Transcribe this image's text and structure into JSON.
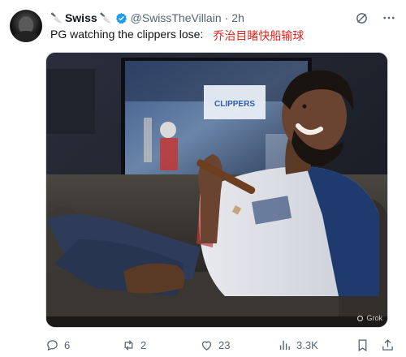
{
  "tweet": {
    "display_name": "Swiss",
    "name_decoration": "🔪",
    "handle": "@SwissTheVillain",
    "separator": "·",
    "time": "2h",
    "text_en": "PG watching the clippers lose:",
    "text_cn": "乔治目睹快船输球",
    "media_watermark": "Grok",
    "scoreboard_text": "CLIPPERS"
  },
  "actions": {
    "replies": "6",
    "retweets": "2",
    "likes": "23",
    "views": "3.3K"
  },
  "colors": {
    "verified": "#1d9bf0",
    "annotation_red": "#e0241b",
    "muted": "#536471"
  }
}
